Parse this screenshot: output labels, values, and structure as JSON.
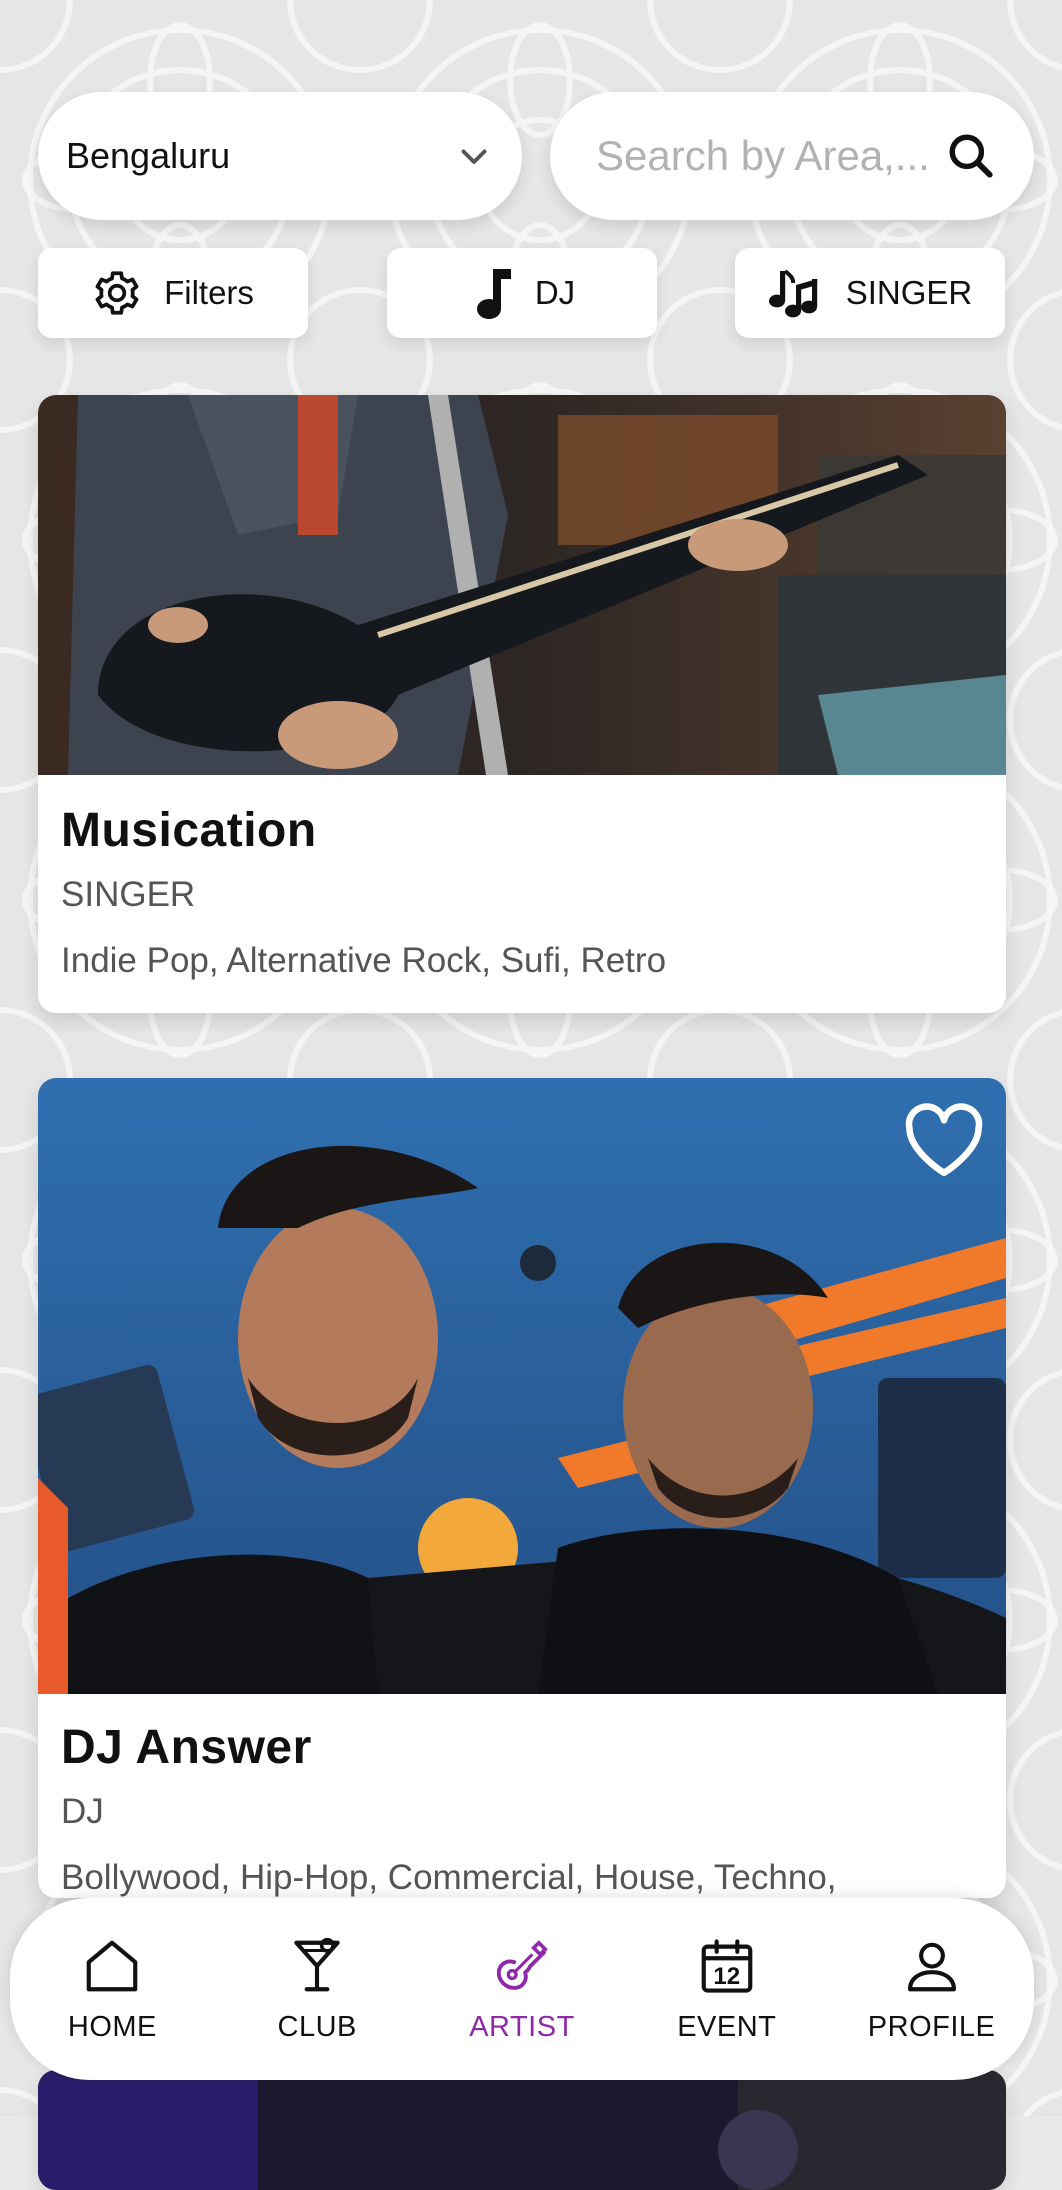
{
  "location": {
    "selected_city": "Bengaluru"
  },
  "search": {
    "placeholder": "Search by Area,..."
  },
  "filters": {
    "filters_label": "Filters",
    "dj_label": "DJ",
    "singer_label": "SINGER"
  },
  "artists": [
    {
      "name": "Musication",
      "type": "SINGER",
      "genres": "Indie Pop, Alternative Rock, Sufi, Retro",
      "favorite_icon": "heart-outline-icon"
    },
    {
      "name": "DJ Answer",
      "type": "DJ",
      "genres": "Bollywood, Hip-Hop, Commercial, House, Techno,",
      "favorite_icon": "heart-outline-icon"
    }
  ],
  "nav": {
    "items": [
      {
        "label": "HOME",
        "icon": "home-icon"
      },
      {
        "label": "CLUB",
        "icon": "cocktail-icon"
      },
      {
        "label": "ARTIST",
        "icon": "guitar-icon"
      },
      {
        "label": "EVENT",
        "icon": "calendar-icon",
        "icon_text": "12"
      },
      {
        "label": "PROFILE",
        "icon": "user-icon"
      }
    ],
    "active": "ARTIST"
  },
  "colors": {
    "accent": "#8e2aa8",
    "background": "#e9e9e9"
  }
}
